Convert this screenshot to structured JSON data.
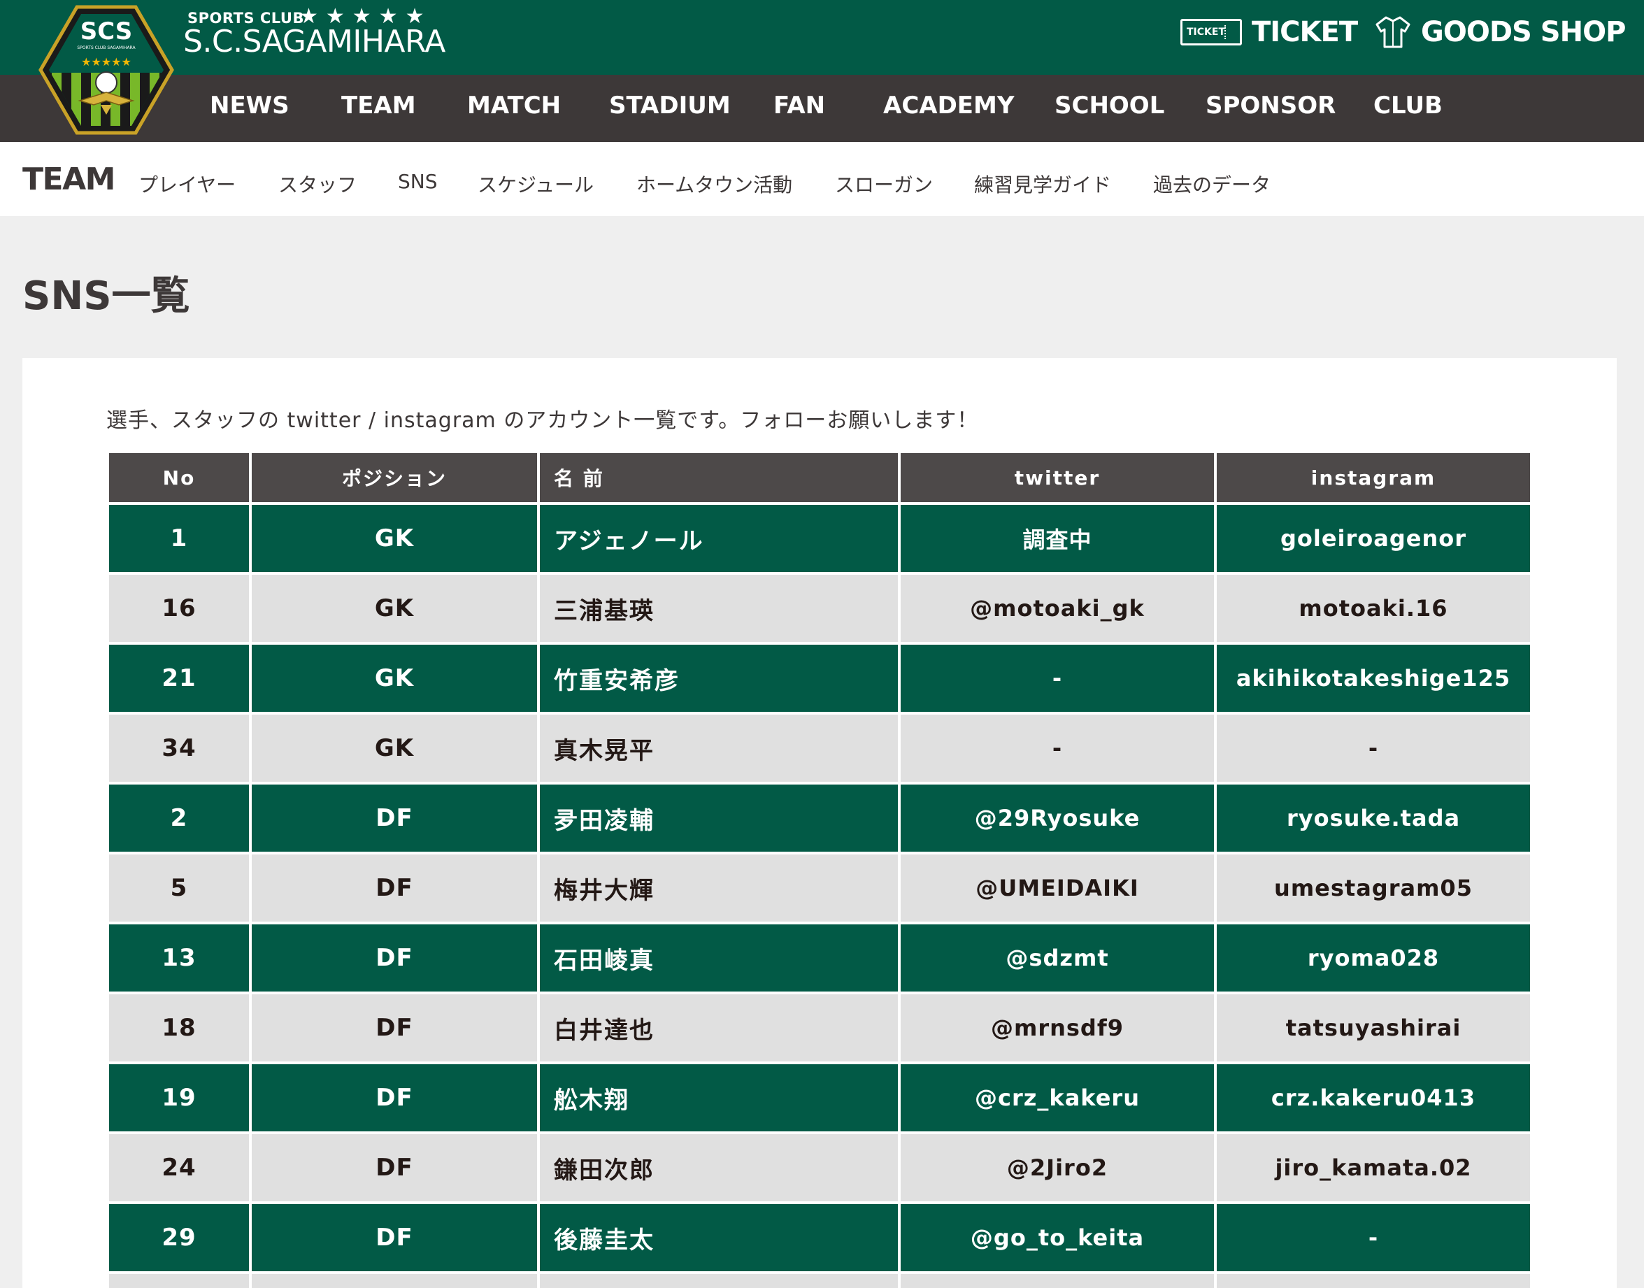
{
  "header": {
    "brand_small": "SPORTS CLUB",
    "brand_stars": "★★★★★",
    "brand_name": "S.C.SAGAMIHARA",
    "emblem_text": "SCS",
    "emblem_subtext": "SPORTS CLUB SAGAMIHARA",
    "ticket_icon_label": "TICKET",
    "ticket_label": "TICKET",
    "goods_label": "GOODS SHOP",
    "colors": {
      "topbar": "#025a46",
      "navbar": "#3d3838",
      "accent_gold": "#f2b705"
    }
  },
  "main_nav": [
    "NEWS",
    "TEAM",
    "MATCH",
    "STADIUM",
    "FAN",
    "ACADEMY",
    "SCHOOL",
    "SPONSOR",
    "CLUB"
  ],
  "sub_nav": {
    "title": "TEAM",
    "items": [
      "プレイヤー",
      "スタッフ",
      "SNS",
      "スケジュール",
      "ホームタウン活動",
      "スローガン",
      "練習見学ガイド",
      "過去のデータ"
    ]
  },
  "page": {
    "title": "SNS一覧",
    "intro": "選手、スタッフの twitter / instagram のアカウント一覧です。フォローお願いします！"
  },
  "table": {
    "headers": {
      "no": "No",
      "position": "ポジション",
      "name": "名 前",
      "twitter": "twitter",
      "instagram": "instagram"
    },
    "rows": [
      {
        "no": "1",
        "position": "GK",
        "name": "アジェノール",
        "twitter": "調査中",
        "instagram": "goleiroagenor"
      },
      {
        "no": "16",
        "position": "GK",
        "name": "三浦基瑛",
        "twitter": "@motoaki_gk",
        "instagram": "motoaki.16"
      },
      {
        "no": "21",
        "position": "GK",
        "name": "竹重安希彦",
        "twitter": "-",
        "instagram": "akihikotakeshige125"
      },
      {
        "no": "34",
        "position": "GK",
        "name": "真木晃平",
        "twitter": "-",
        "instagram": "-"
      },
      {
        "no": "2",
        "position": "DF",
        "name": "夛田凌輔",
        "twitter": "@29Ryosuke",
        "instagram": "ryosuke.tada"
      },
      {
        "no": "5",
        "position": "DF",
        "name": "梅井大輝",
        "twitter": "@UMEIDAIKI",
        "instagram": "umestagram05"
      },
      {
        "no": "13",
        "position": "DF",
        "name": "石田崚真",
        "twitter": "@sdzmt",
        "instagram": "ryoma028"
      },
      {
        "no": "18",
        "position": "DF",
        "name": "白井達也",
        "twitter": "@mrnsdf9",
        "instagram": "tatsuyashirai"
      },
      {
        "no": "19",
        "position": "DF",
        "name": "舩木翔",
        "twitter": "@crz_kakeru",
        "instagram": "crz.kakeru0413"
      },
      {
        "no": "24",
        "position": "DF",
        "name": "鎌田次郎",
        "twitter": "@2Jiro2",
        "instagram": "jiro_kamata.02"
      },
      {
        "no": "29",
        "position": "DF",
        "name": "後藤圭太",
        "twitter": "@go_to_keita",
        "instagram": "-"
      }
    ]
  }
}
